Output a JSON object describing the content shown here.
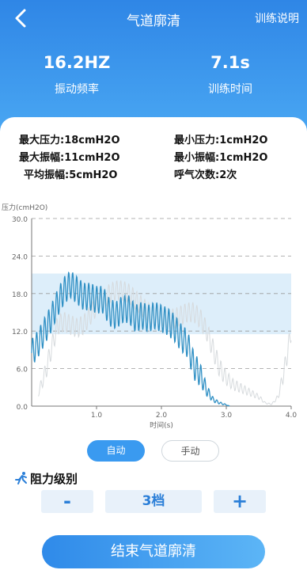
{
  "header": {
    "title": "气道廓清",
    "right_action": "训练说明"
  },
  "stats": {
    "frequency_value": "16.2HZ",
    "frequency_label": "振动频率",
    "time_value": "7.1s",
    "time_label": "训练时间"
  },
  "metrics": {
    "max_pressure": "最大压力:18cmH2O",
    "min_pressure": "最小压力:1cmH2O",
    "max_amplitude": "最大振幅:11cmH2O",
    "min_amplitude": "最小振幅:1cmH2O",
    "avg_amplitude": "平均振幅:5cmH2O",
    "breath_count": "呼气次数:2次"
  },
  "chart_data": {
    "type": "line",
    "ylabel": "压力(cmH2O)",
    "xlabel": "时间(s)",
    "xlim": [
      0,
      4.0
    ],
    "ylim": [
      0,
      30.0
    ],
    "x_ticks": [
      "1.0",
      "2.0",
      "3.0",
      "4.0"
    ],
    "y_ticks": [
      "0.0",
      "6.0",
      "12.0",
      "18.0",
      "24.0",
      "30.0"
    ],
    "target_band": [
      11.5,
      21.2
    ],
    "series": [
      {
        "x": [
          0.0,
          0.1,
          0.2,
          0.3,
          0.4,
          0.5,
          0.6,
          0.7,
          0.8,
          0.9,
          1.0,
          1.1,
          1.2,
          1.3,
          1.4,
          1.5,
          1.6,
          1.7,
          1.8,
          1.9,
          2.0,
          2.1,
          2.2,
          2.3,
          2.4,
          2.5,
          2.6,
          2.7,
          2.8,
          2.9,
          3.0,
          3.05
        ],
        "y": [
          8.5,
          10.0,
          12.0,
          14.0,
          16.5,
          18.5,
          19.5,
          18.5,
          17.5,
          17.5,
          17.0,
          17.0,
          15.0,
          14.5,
          15.5,
          15.5,
          14.0,
          14.5,
          14.0,
          14.5,
          14.0,
          13.5,
          12.5,
          11.0,
          10.0,
          6.5,
          5.0,
          2.5,
          1.0,
          0.5,
          0.2,
          0.0
        ]
      },
      {
        "x": [
          0.1,
          0.2,
          0.3,
          0.4,
          0.5,
          0.6,
          0.7,
          0.8,
          0.9,
          1.0,
          1.1,
          1.2,
          1.3,
          1.4,
          1.5,
          1.6,
          1.7,
          1.8,
          1.9,
          2.0,
          2.1,
          2.2,
          2.3,
          2.4,
          2.5,
          2.6,
          2.7,
          2.8,
          2.9,
          3.0,
          3.1,
          3.2,
          3.3,
          3.4,
          3.5,
          3.6,
          3.7,
          3.8,
          3.9,
          4.0
        ],
        "y": [
          2.0,
          5.0,
          9.0,
          13.0,
          13.5,
          13.0,
          12.5,
          13.0,
          14.5,
          16.0,
          17.0,
          18.0,
          18.5,
          18.5,
          18.0,
          17.0,
          16.0,
          15.0,
          14.0,
          14.5,
          14.0,
          14.0,
          14.5,
          15.0,
          15.0,
          14.0,
          12.0,
          9.0,
          6.0,
          4.5,
          3.5,
          3.0,
          2.5,
          2.0,
          1.5,
          0.5,
          0.3,
          1.5,
          6.0,
          12.0
        ]
      }
    ]
  },
  "mode": {
    "auto_label": "自动",
    "manual_label": "手动"
  },
  "resistance": {
    "title": "阻力级别",
    "level": "3档",
    "minus": "-",
    "plus": "+"
  },
  "end_button": "结束气道廓清",
  "colors": {
    "primary": "#3a9af0",
    "line": "#2e8fc4",
    "ghost_line": "#d6dadd",
    "band": "#cfe7f8"
  }
}
